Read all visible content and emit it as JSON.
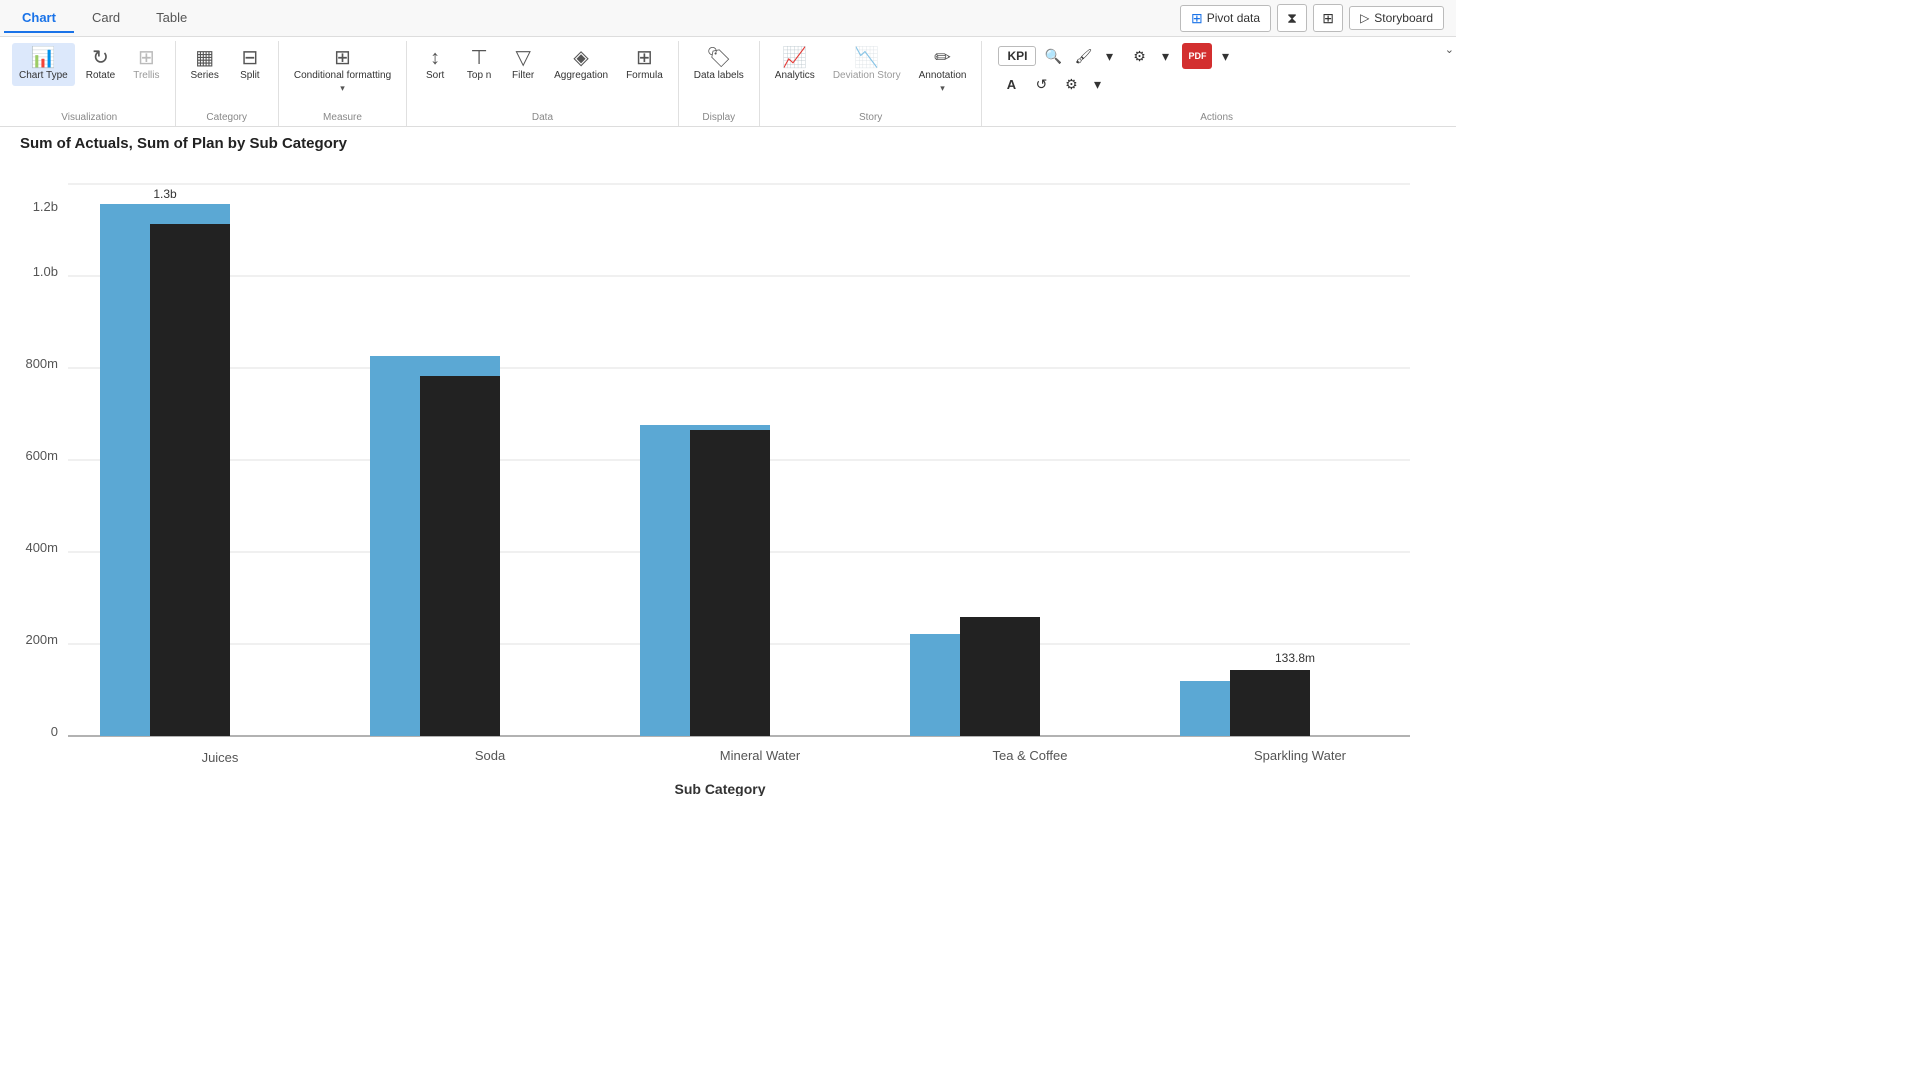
{
  "tabs": [
    {
      "label": "Chart",
      "active": true
    },
    {
      "label": "Card",
      "active": false
    },
    {
      "label": "Table",
      "active": false
    }
  ],
  "topright": {
    "pivot_label": "Pivot  data",
    "storyboard_label": "Storyboard"
  },
  "ribbon": {
    "visualization": {
      "label": "Visualization",
      "buttons": [
        {
          "id": "chart-type",
          "label": "Chart Type",
          "icon": "📊"
        },
        {
          "id": "rotate",
          "label": "Rotate",
          "icon": "🔄"
        },
        {
          "id": "trellis",
          "label": "Trellis",
          "icon": "⊞",
          "disabled": true
        }
      ]
    },
    "category": {
      "label": "Category",
      "buttons": [
        {
          "id": "series",
          "label": "Series",
          "icon": "▦"
        },
        {
          "id": "split",
          "label": "Split",
          "icon": "⊟"
        }
      ]
    },
    "measure": {
      "label": "Measure",
      "buttons": [
        {
          "id": "conditional",
          "label": "Conditional formatting",
          "icon": "⊞",
          "has_arrow": true
        }
      ]
    },
    "data": {
      "label": "Data",
      "buttons": [
        {
          "id": "sort",
          "label": "Sort",
          "icon": "↕"
        },
        {
          "id": "top-n",
          "label": "Top n",
          "icon": "⊤"
        },
        {
          "id": "filter",
          "label": "Filter",
          "icon": "▽"
        },
        {
          "id": "aggregation",
          "label": "Aggregation",
          "icon": "◈"
        },
        {
          "id": "formula",
          "label": "Formula",
          "icon": "⊞"
        }
      ]
    },
    "display": {
      "label": "Display",
      "buttons": [
        {
          "id": "data-labels",
          "label": "Data labels",
          "icon": "🏷"
        }
      ]
    },
    "story": {
      "label": "Story",
      "buttons": [
        {
          "id": "analytics",
          "label": "Analytics",
          "icon": "📈"
        },
        {
          "id": "deviation",
          "label": "Deviation Story",
          "icon": "📉",
          "disabled": true
        },
        {
          "id": "annotation",
          "label": "Annotation",
          "icon": "✎",
          "has_arrow": true
        }
      ]
    }
  },
  "chart": {
    "title": "Sum of Actuals, Sum of Plan by Sub Category",
    "x_label": "Sub Category",
    "y_labels": [
      "0",
      "200m",
      "400m",
      "600m",
      "800m",
      "1.0b",
      "1.2b"
    ],
    "data_label_1": "1.3b",
    "data_label_2": "133.8m",
    "categories": [
      "Juices",
      "Soda",
      "Mineral Water",
      "Tea & Coffee",
      "Sparkling Water"
    ],
    "actuals_color": "#5ba8d4",
    "plan_color": "#222",
    "series": [
      {
        "cat": "Juices",
        "actuals": 1300,
        "plan": 1260
      },
      {
        "cat": "Soda",
        "actuals": 930,
        "plan": 880
      },
      {
        "cat": "Mineral Water",
        "actuals": 760,
        "plan": 750
      },
      {
        "cat": "Tea & Coffee",
        "actuals": 250,
        "plan": 290
      },
      {
        "cat": "Sparkling Water",
        "actuals": 134,
        "plan": 160
      }
    ]
  }
}
